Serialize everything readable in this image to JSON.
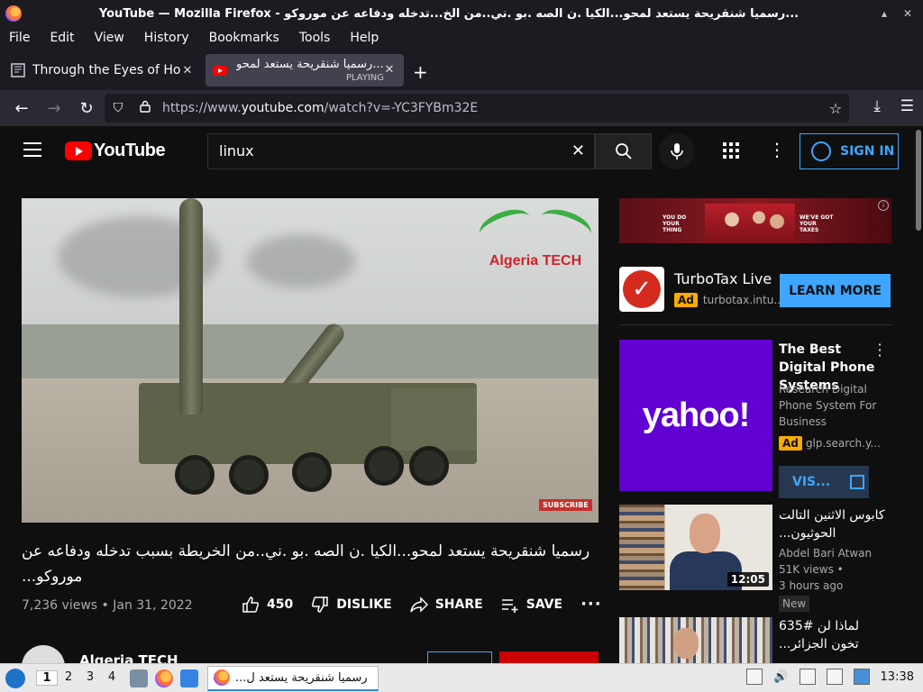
{
  "window": {
    "title": "YouTube — Mozilla Firefox - رسميا شنقريحة يستعد لمحو...الكيا .ن الصه .بو .ني..من الخ...تدخله ودفاعه عن موروكو..."
  },
  "menubar": [
    "File",
    "Edit",
    "View",
    "History",
    "Bookmarks",
    "Tools",
    "Help"
  ],
  "tabs": [
    {
      "label": "Through the Eyes of Hope"
    },
    {
      "label": "رسميا شنقريحة يستعد لمحو...",
      "status": "PLAYING"
    }
  ],
  "nav": {
    "url_prefix": "https://www.",
    "url_domain": "youtube.com",
    "url_rest": "/watch?v=-YC3FYBm32E"
  },
  "youtube": {
    "logo_text": "YouTube",
    "search_value": "linux",
    "sign_in": "SIGN IN"
  },
  "video": {
    "watermark": "Algeria TECH",
    "subscribe_overlay": "SUBSCRIBE",
    "title": "رسميا شنقريحة يستعد لمحو...الكيا .ن الصه .بو .ني..من الخريطة بسبب تدخله ودفاعه عن موروكو...",
    "views": "7,236 views",
    "date": "Jan 31, 2022",
    "likes": "450",
    "dislike": "DISLIKE",
    "share": "SHARE",
    "save": "SAVE",
    "channel": "Algeria TECH"
  },
  "sidebar": {
    "banner": {
      "left_text": "YOU DO YOUR THING",
      "right_text": "WE'VE GOT YOUR TAXES"
    },
    "turbotax": {
      "name": "TurboTax Live",
      "ad": "Ad",
      "domain": "turbotax.intu...",
      "cta": "LEARN MORE"
    },
    "yahoo": {
      "logo": "yahoo!",
      "title": "The Best Digital Phone Systems",
      "desc": "Research Digital Phone System For Business",
      "ad": "Ad",
      "domain": "glp.search.y...",
      "cta": "VIS..."
    },
    "video1": {
      "title": "كابوس الاثنين التالت الحوثيون...",
      "channel": "Abdel Bari Atwan",
      "views": "51K views",
      "age": "3 hours ago",
      "badge": "New",
      "duration": "12:05"
    },
    "video2": {
      "title": "لماذا لن #635 تخون الجزائر..."
    }
  },
  "taskbar": {
    "workspaces": [
      "1",
      "2",
      "3",
      "4"
    ],
    "task_label": "رسميا شنقريحة يستعد ل...",
    "clock": "13:38"
  }
}
